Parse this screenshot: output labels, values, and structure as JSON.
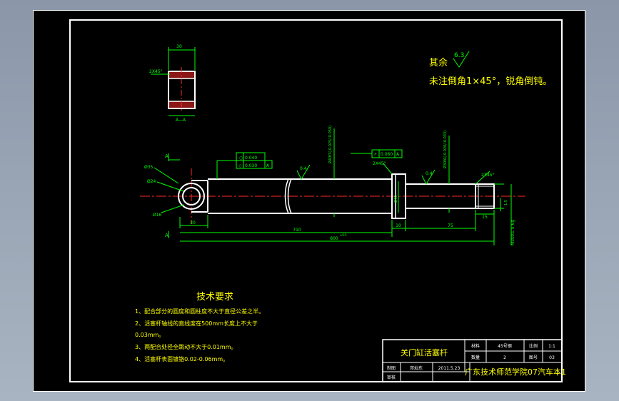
{
  "notes": {
    "remaining_label": "其余",
    "remaining_roughness": "6.3",
    "chamfer_note": "未注倒角1×45°，锐角倒钝。"
  },
  "section": {
    "width_dim": "30",
    "chamfer": "2X45°",
    "label": "A—A"
  },
  "part": {
    "label_a": "A",
    "dia_35": "Ø35",
    "dia_24": "Ø24",
    "dia_16": "Ø16",
    "dim_30": "30",
    "dim_710": "710",
    "dim_800": "800",
    "dim_800_tol": "±0.5",
    "dim_10": "10",
    "dim_75": "75",
    "dim_15": "15",
    "dim_15b": "1.5",
    "chamfer_mid": "2X45°",
    "chamfer_end": "2X45°",
    "rough_04a": "0.4",
    "rough_04b": "0.4",
    "dia_main": "Ø40f7(-0.025/-0.050)",
    "dia_rod": "Ø30f6(-0.020/-0.033)",
    "dia_40": "Ø40",
    "thread": "M30X1.5-6g",
    "tol_circ_sym": "○",
    "tol_circ_val": "0.040",
    "tol_flat_sym": "◇",
    "tol_flat_val": "0.030",
    "tol_ref": "A",
    "tol_runout_sym": "↗",
    "tol_runout_val": "0.060",
    "tol_runout_ref": "A"
  },
  "requirements": {
    "title": "技术要求",
    "items": [
      "1、配合部分的圆度和圆柱度不大于直径公差之半。",
      "2、活塞杆轴线的直线度在500mm长度上不大于",
      "0.03mm。",
      "3、两配合处径全跳动不大于0.01mm。",
      "4、活塞杆表面镀铬0.02-0.06mm。"
    ]
  },
  "title_block": {
    "part_name": "关门缸活塞杆",
    "material_label": "材料",
    "material": "45号钢",
    "scale_label": "比例",
    "scale": "1:1",
    "qty_label": "数量",
    "qty": "2",
    "drawing_no_label": "图号",
    "drawing_no": "03",
    "drawn_label": "制图",
    "drawn_by": "邓灿东",
    "date": "2011.5.23",
    "check_label": "审核",
    "school": "广东技术师范学院07汽车本1"
  }
}
